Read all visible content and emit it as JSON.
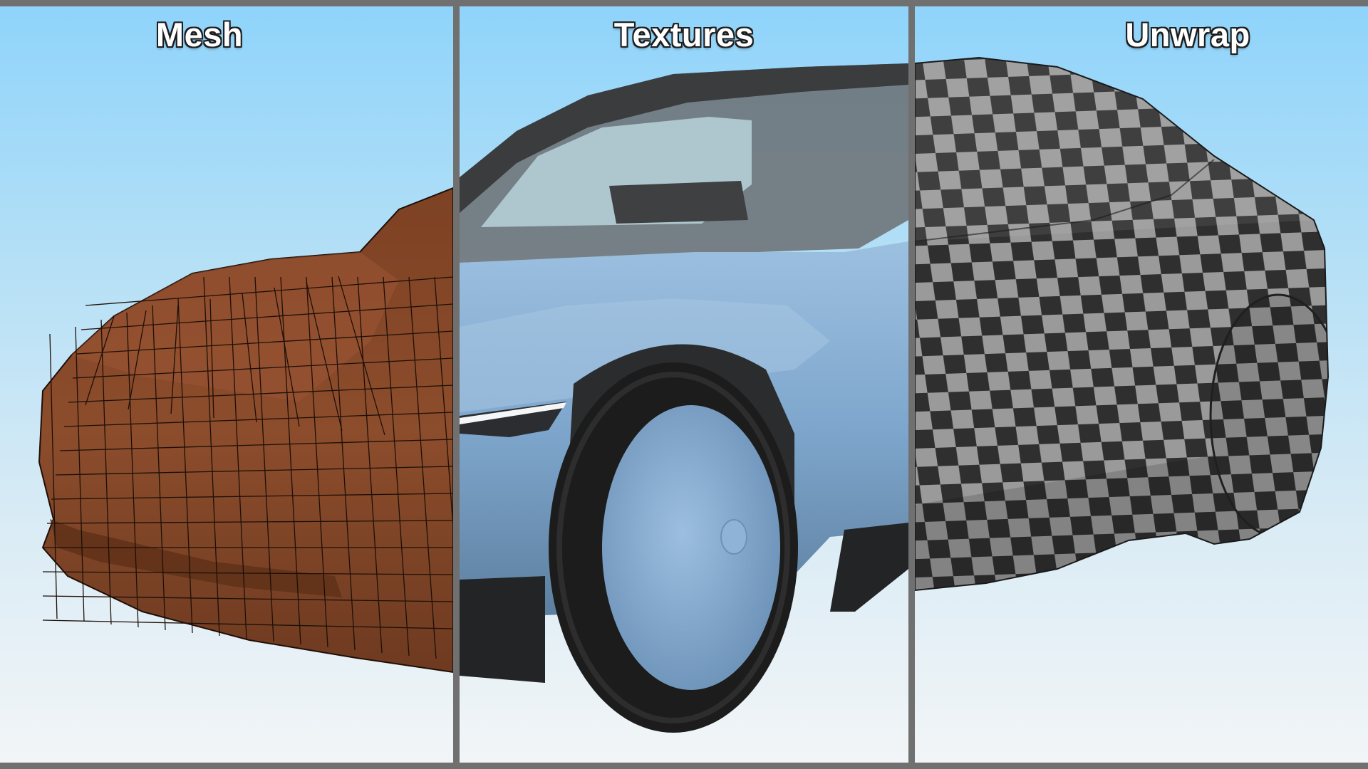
{
  "panels": [
    {
      "id": "mesh",
      "title": "Mesh"
    },
    {
      "id": "textures",
      "title": "Textures"
    },
    {
      "id": "unwrap",
      "title": "Unwrap"
    }
  ],
  "colors": {
    "sky_top": "#8fd4fb",
    "sky_bottom": "#f2f5f7",
    "divider": "#707070",
    "mesh_body": "#8a4a2a",
    "mesh_wire": "#1e0f08",
    "car_paint": "#7ea6cc",
    "tire": "#1c1c1c",
    "checker_dark": "#2f2f2f",
    "checker_light": "#9a9a9a"
  }
}
